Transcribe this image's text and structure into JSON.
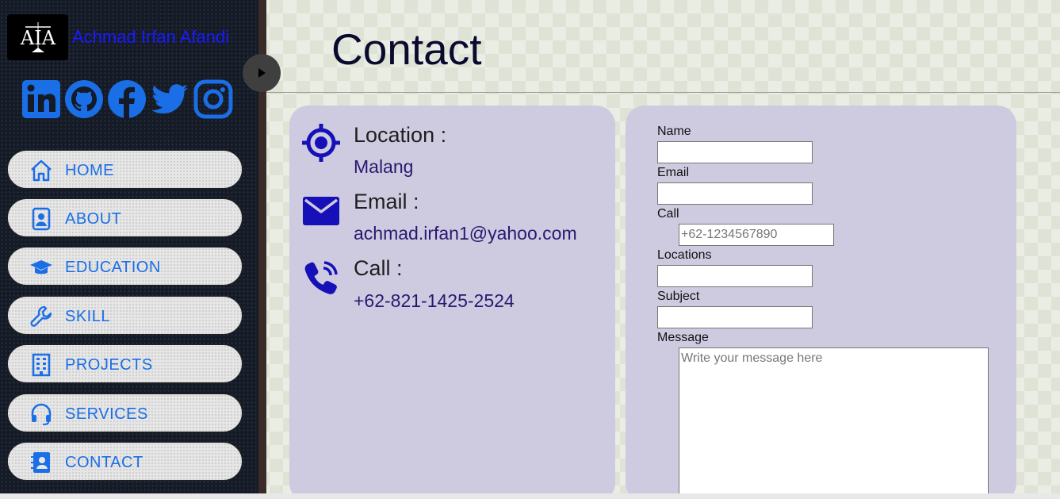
{
  "brand": {
    "name": "Achmad Irfan Afandi",
    "logo_text": "AIA"
  },
  "socials": [
    {
      "name": "linkedin",
      "icon": "linkedin-icon"
    },
    {
      "name": "github",
      "icon": "github-icon"
    },
    {
      "name": "facebook",
      "icon": "facebook-icon"
    },
    {
      "name": "twitter",
      "icon": "twitter-icon"
    },
    {
      "name": "instagram",
      "icon": "instagram-icon"
    }
  ],
  "nav": {
    "items": [
      {
        "label": "HOME",
        "icon": "home-icon"
      },
      {
        "label": "ABOUT",
        "icon": "profile-icon"
      },
      {
        "label": "EDUCATION",
        "icon": "graduation-cap-icon"
      },
      {
        "label": "SKILL",
        "icon": "wrench-icon"
      },
      {
        "label": "PROJECTS",
        "icon": "building-icon"
      },
      {
        "label": "SERVICES",
        "icon": "headset-icon"
      },
      {
        "label": "CONTACT",
        "icon": "contact-book-icon"
      }
    ]
  },
  "header": {
    "title": "Contact"
  },
  "contact_info": {
    "location": {
      "heading": "Location :",
      "value": "Malang",
      "icon": "crosshair-icon"
    },
    "email": {
      "heading": "Email :",
      "value": "achmad.irfan1@yahoo.com",
      "icon": "envelope-icon"
    },
    "call": {
      "heading": "Call :",
      "value": "+62-821-1425-2524",
      "icon": "phone-icon"
    }
  },
  "form": {
    "name_label": "Name",
    "name_value": "",
    "email_label": "Email",
    "email_value": "",
    "call_label": "Call",
    "call_placeholder": "+62-1234567890",
    "locations_label": "Locations",
    "locations_value": "",
    "subject_label": "Subject",
    "subject_value": "",
    "message_label": "Message",
    "message_placeholder": "Write your message here"
  },
  "colors": {
    "accent": "#1a6ee6",
    "brand_text": "#1a1aff",
    "card_bg": "#cecbe0",
    "icon_dark": "#1510b8",
    "sidebar_bg": "#141a26"
  }
}
